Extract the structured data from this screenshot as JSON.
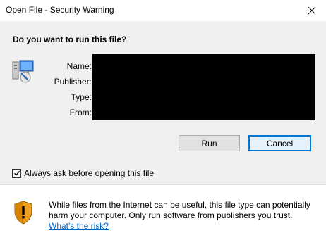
{
  "window": {
    "title": "Open File - Security Warning",
    "close_icon": "close-icon"
  },
  "dialog": {
    "question": "Do you want to run this file?",
    "file_icon": "installer-icon",
    "fields": {
      "name_label": "Name:",
      "publisher_label": "Publisher:",
      "type_label": "Type:",
      "from_label": "From:"
    },
    "buttons": {
      "run": "Run",
      "cancel": "Cancel"
    },
    "checkbox": {
      "label": "Always ask before opening this file",
      "checked": true
    }
  },
  "footer": {
    "warning_icon": "shield-warning-icon",
    "warning_text": "While files from the Internet can be useful, this file type can potentially harm your computer. Only run software from publishers you trust.",
    "risk_link": "What's the risk?"
  },
  "colors": {
    "accent": "#0078d7",
    "link": "#0066cc",
    "content_bg": "#f0f0f0"
  }
}
